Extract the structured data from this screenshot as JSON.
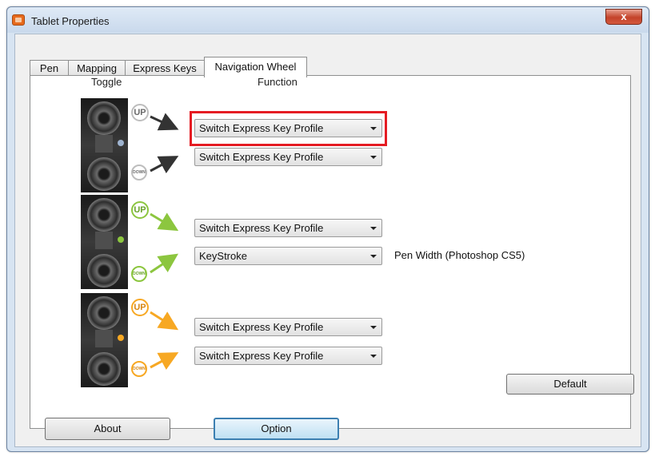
{
  "window": {
    "title": "Tablet Properties",
    "close_glyph": "x"
  },
  "tabs": [
    {
      "label": "Pen"
    },
    {
      "label": "Mapping"
    },
    {
      "label": "Express Keys"
    },
    {
      "label": "Navigation Wheel",
      "active": true
    }
  ],
  "headers": {
    "toggle": "Toggle",
    "function": "Function"
  },
  "groups": [
    {
      "color": "#c8c8c8",
      "led_color": "#9fb4d0",
      "up_label": "UP",
      "down_label": "DOWN",
      "up_function": "Switch Express Key Profile",
      "down_function": "Switch Express Key Profile",
      "up_highlighted": true
    },
    {
      "color": "#8cc63f",
      "led_color": "#8cc63f",
      "up_label": "UP",
      "down_label": "DOWN",
      "up_function": "Switch Express Key Profile",
      "down_function": "KeyStroke",
      "down_note": "Pen Width (Photoshop CS5)"
    },
    {
      "color": "#f7a823",
      "led_color": "#f7a823",
      "up_label": "UP",
      "down_label": "DOWN",
      "up_function": "Switch Express Key Profile",
      "down_function": "Switch Express Key Profile"
    }
  ],
  "buttons": {
    "default": "Default",
    "about": "About",
    "option": "Option"
  },
  "colors": {
    "highlight": "#e51c23",
    "accent": "#3c7fb1"
  }
}
